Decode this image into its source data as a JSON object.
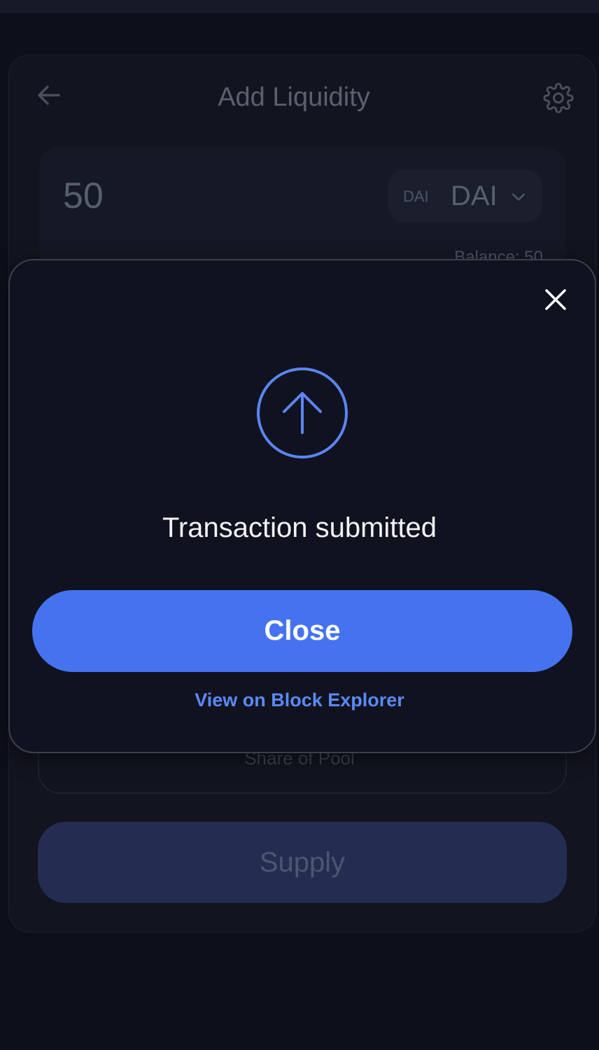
{
  "background_card": {
    "title": "Add Liquidity",
    "back_icon": "arrow-left-icon",
    "settings_icon": "gear-icon",
    "input": {
      "amount": "50",
      "token_logo_label": "DAI",
      "token_symbol": "DAI",
      "balance_label": "Balance: 50"
    },
    "share_label": "Share of Pool",
    "supply_label": "Supply"
  },
  "modal": {
    "title": "Transaction submitted",
    "close_icon": "close-icon",
    "status_icon": "arrow-up-circle-icon",
    "close_button_label": "Close",
    "explorer_link_label": "View on Block Explorer"
  },
  "colors": {
    "background": "#0d0f1b",
    "modal_border": "#3c404c",
    "accent": "#4573ef",
    "link": "#5a8af5",
    "icon_accent": "#5b86f2"
  }
}
